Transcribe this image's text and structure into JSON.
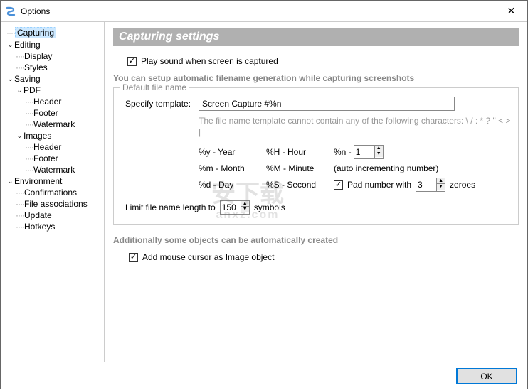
{
  "window": {
    "title": "Options"
  },
  "tree": {
    "capturing": "Capturing",
    "editing": "Editing",
    "display": "Display",
    "styles": "Styles",
    "saving": "Saving",
    "pdf": "PDF",
    "header": "Header",
    "footer": "Footer",
    "watermark": "Watermark",
    "images": "Images",
    "environment": "Environment",
    "confirmations": "Confirmations",
    "file_associations": "File associations",
    "update": "Update",
    "hotkeys": "Hotkeys"
  },
  "page": {
    "title": "Capturing settings",
    "play_sound": "Play sound when screen is captured",
    "filename_intro": "You can setup automatic filename generation while capturing screenshots",
    "default_filename": "Default file name",
    "specify_template": "Specify template:",
    "template_value": "Screen Capture #%n",
    "template_hint": "The file name template cannot contain any of the following characters:  \\ / : * ? \" < > |",
    "code_y": "%y - Year",
    "code_m": "%m - Month",
    "code_d": "%d - Day",
    "code_H": "%H - Hour",
    "code_M": "%M - Minute",
    "code_S": "%S - Second",
    "code_n_label": "%n -",
    "code_n_value": "1",
    "auto_inc": "(auto incrementing number)",
    "pad_number": "Pad number with",
    "pad_value": "3",
    "zeroes": "zeroes",
    "limit_label": "Limit file name length to",
    "limit_value": "150",
    "symbols": "symbols",
    "additional_intro": "Additionally some objects can be automatically created",
    "add_mouse": "Add mouse cursor as Image object"
  },
  "buttons": {
    "ok": "OK"
  }
}
